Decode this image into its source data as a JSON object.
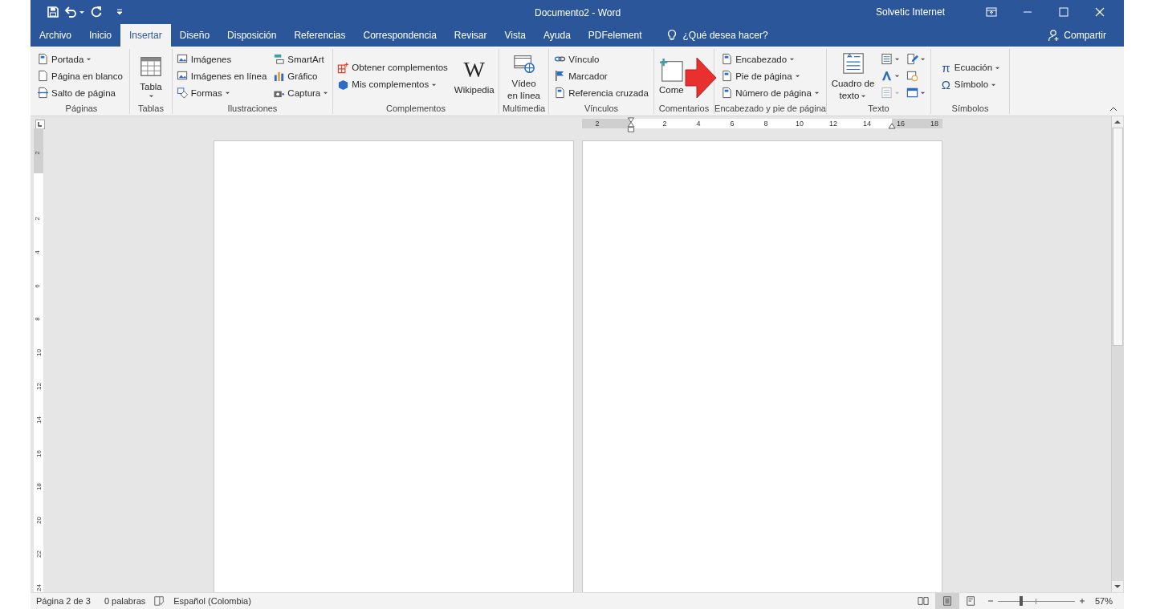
{
  "title_bar": {
    "title": "Documento2 - Word",
    "user": "Solvetic Internet"
  },
  "tabs": [
    {
      "label": "Archivo",
      "selected": false
    },
    {
      "label": "Inicio",
      "selected": false
    },
    {
      "label": "Insertar",
      "selected": true
    },
    {
      "label": "Diseño",
      "selected": false
    },
    {
      "label": "Disposición",
      "selected": false
    },
    {
      "label": "Referencias",
      "selected": false
    },
    {
      "label": "Correspondencia",
      "selected": false
    },
    {
      "label": "Revisar",
      "selected": false
    },
    {
      "label": "Vista",
      "selected": false
    },
    {
      "label": "Ayuda",
      "selected": false
    },
    {
      "label": "PDFelement",
      "selected": false
    }
  ],
  "tell_me": "¿Qué desea hacer?",
  "share": "Compartir",
  "ribbon": {
    "groups": [
      {
        "label": "Páginas",
        "columns": [
          [
            {
              "kind": "small",
              "label": "Portada",
              "dropdown": true
            },
            {
              "kind": "small",
              "label": "Página en blanco",
              "dropdown": false
            },
            {
              "kind": "small",
              "label": "Salto de página",
              "dropdown": false
            }
          ]
        ]
      },
      {
        "label": "Tablas",
        "columns": [
          [
            {
              "kind": "large",
              "lines": [
                "Tabla"
              ],
              "dropdown": true
            }
          ]
        ]
      },
      {
        "label": "Ilustraciones",
        "columns": [
          [
            {
              "kind": "small",
              "label": "Imágenes",
              "dropdown": false
            },
            {
              "kind": "small",
              "label": "Imágenes en línea",
              "dropdown": false
            },
            {
              "kind": "small",
              "label": "Formas",
              "dropdown": true
            }
          ],
          [
            {
              "kind": "small",
              "label": "SmartArt",
              "dropdown": false
            },
            {
              "kind": "small",
              "label": "Gráfico",
              "dropdown": false
            },
            {
              "kind": "small",
              "label": "Captura",
              "dropdown": true
            }
          ]
        ]
      },
      {
        "label": "Complementos",
        "columns": [
          [
            {
              "kind": "small",
              "label": "Obtener complementos",
              "dropdown": false
            },
            {
              "kind": "small",
              "label": "Mis complementos",
              "dropdown": true
            }
          ],
          [
            {
              "kind": "large",
              "glyph": "W",
              "lines": [
                "Wikipedia"
              ],
              "dropdown": false
            }
          ]
        ]
      },
      {
        "label": "Multimedia",
        "columns": [
          [
            {
              "kind": "large",
              "lines": [
                "Vídeo",
                "en línea"
              ],
              "dropdown": false
            }
          ]
        ]
      },
      {
        "label": "Vínculos",
        "columns": [
          [
            {
              "kind": "small",
              "label": "Vínculo",
              "dropdown": false
            },
            {
              "kind": "small",
              "label": "Marcador",
              "dropdown": false
            },
            {
              "kind": "small",
              "label": "Referencia cruzada",
              "dropdown": false
            }
          ]
        ]
      },
      {
        "label": "Comentarios",
        "columns": [
          [
            {
              "kind": "large",
              "lines": [
                "Come"
              ],
              "dropdown": false
            }
          ]
        ]
      },
      {
        "label": "Encabezado y pie de página",
        "columns": [
          [
            {
              "kind": "small",
              "label": "Encabezado",
              "dropdown": true
            },
            {
              "kind": "small",
              "label": "Pie de página",
              "dropdown": true
            },
            {
              "kind": "small",
              "label": "Número de página",
              "dropdown": true
            }
          ]
        ]
      },
      {
        "label": "Texto",
        "columns": [
          [
            {
              "kind": "large",
              "lines": [
                "Cuadro de",
                "texto"
              ],
              "dropdown": true
            }
          ],
          [
            {
              "kind": "icon",
              "dropdown": true,
              "disabled": false
            },
            {
              "kind": "icon",
              "dropdown": true,
              "disabled": false
            },
            {
              "kind": "icon",
              "dropdown": true,
              "disabled": true
            }
          ],
          [
            {
              "kind": "icon",
              "dropdown": true,
              "disabled": false
            },
            {
              "kind": "icon",
              "dropdown": false,
              "disabled": false
            },
            {
              "kind": "icon",
              "dropdown": true,
              "disabled": false
            }
          ]
        ]
      },
      {
        "label": "Símbolos",
        "columns": [
          [
            {
              "kind": "small",
              "glyph": "π",
              "label": "Ecuación",
              "dropdown": true
            },
            {
              "kind": "small",
              "glyph": "Ω",
              "label": "Símbolo",
              "dropdown": true
            }
          ]
        ]
      }
    ]
  },
  "horizontal_ruler": [
    "2",
    "2",
    "4",
    "6",
    "8",
    "10",
    "12",
    "14",
    "16",
    "18"
  ],
  "vertical_ruler": [
    "2",
    "2",
    "4",
    "6",
    "8",
    "10",
    "12",
    "14",
    "16",
    "18",
    "20",
    "22",
    "24"
  ],
  "status_bar": {
    "page": "Página 2 de 3",
    "words": "0 palabras",
    "language": "Español (Colombia)",
    "views": [
      {
        "selected": false
      },
      {
        "selected": true
      },
      {
        "selected": false
      }
    ],
    "zoom": {
      "level": 0.3,
      "reading": "57%"
    }
  }
}
